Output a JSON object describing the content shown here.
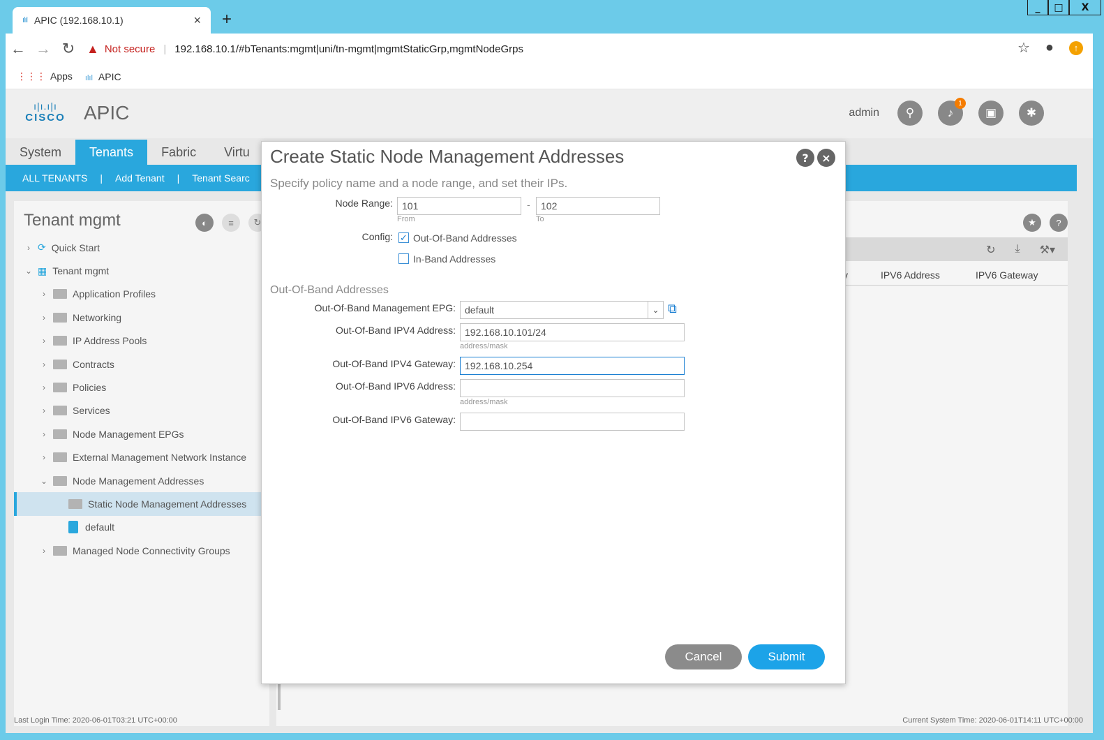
{
  "browser": {
    "tab_title": "APIC (192.168.10.1)",
    "tab_close": "×",
    "new_tab": "+",
    "not_secure": "Not secure",
    "url": "192.168.10.1/#bTenants:mgmt|uni/tn-mgmt|mgmtStaticGrp,mgmtNodeGrps",
    "bookmarks": [
      "Apps",
      "APIC"
    ],
    "window_controls": [
      "_",
      "□",
      "X"
    ]
  },
  "app": {
    "title": "APIC",
    "logo_text": "CISCO",
    "user": "admin",
    "notification_count": "1",
    "main_tabs": [
      "System",
      "Tenants",
      "Fabric",
      "Virtu"
    ],
    "sub_nav": [
      "ALL TENANTS",
      "|",
      "Add Tenant",
      "|",
      "Tenant Searc"
    ]
  },
  "tree": {
    "title": "Tenant mgmt",
    "items": [
      {
        "label": "Quick Start"
      },
      {
        "label": "Tenant mgmt"
      },
      {
        "label": "Application Profiles"
      },
      {
        "label": "Networking"
      },
      {
        "label": "IP Address Pools"
      },
      {
        "label": "Contracts"
      },
      {
        "label": "Policies"
      },
      {
        "label": "Services"
      },
      {
        "label": "Node Management EPGs"
      },
      {
        "label": "External Management Network Instance"
      },
      {
        "label": "Node Management Addresses"
      },
      {
        "label": "Static Node Management Addresses"
      },
      {
        "label": "default"
      },
      {
        "label": "Managed Node Connectivity Groups"
      }
    ]
  },
  "table": {
    "columns": [
      "y",
      "IPV6 Address",
      "IPV6 Gateway"
    ]
  },
  "footer": {
    "last_login": "Last Login Time: 2020-06-01T03:21 UTC+00:00",
    "current_time": "Current System Time: 2020-06-01T14:11 UTC+00:00"
  },
  "dialog": {
    "title": "Create Static Node Management Addresses",
    "subtitle": "Specify policy name and a node range, and set their IPs.",
    "node_range_label": "Node Range:",
    "node_from": "101",
    "node_to": "102",
    "range_dash": "-",
    "from_hint": "From",
    "to_hint": "To",
    "config_label": "Config:",
    "oob_checkbox_label": "Out-Of-Band Addresses",
    "oob_checked": true,
    "inband_checkbox_label": "In-Band Addresses",
    "inband_checked": false,
    "section_title": "Out-Of-Band Addresses",
    "epg_label": "Out-Of-Band Management EPG:",
    "epg_value": "default",
    "ipv4_addr_label": "Out-Of-Band IPV4 Address:",
    "ipv4_addr_value": "192.168.10.101/24",
    "ipv4_addr_hint": "address/mask",
    "ipv4_gw_label": "Out-Of-Band IPV4 Gateway:",
    "ipv4_gw_value": "192.168.10.254",
    "ipv6_addr_label": "Out-Of-Band IPV6 Address:",
    "ipv6_addr_value": "",
    "ipv6_addr_hint": "address/mask",
    "ipv6_gw_label": "Out-Of-Band IPV6 Gateway:",
    "ipv6_gw_value": "",
    "cancel_label": "Cancel",
    "submit_label": "Submit"
  },
  "colors": {
    "accent": "#29a7dd",
    "submit": "#1ca3e8",
    "cancel": "#8b8b8b",
    "warning": "#c5221f"
  }
}
